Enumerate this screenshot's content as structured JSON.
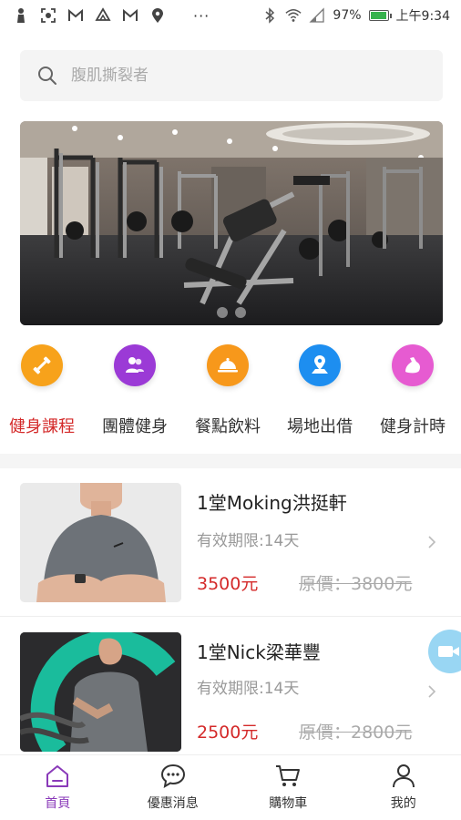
{
  "status_bar": {
    "dots": "···",
    "battery": "97%",
    "time": "上午9:34"
  },
  "search": {
    "placeholder": "腹肌撕裂者"
  },
  "banner": {
    "active_index": 0,
    "count": 2
  },
  "categories": [
    {
      "label": "健身課程",
      "icon": "dumbbell-icon",
      "color": "#f7a21b",
      "active": true
    },
    {
      "label": "團體健身",
      "icon": "group-icon",
      "color": "#9b3ad6",
      "active": false
    },
    {
      "label": "餐點飲料",
      "icon": "food-tray-icon",
      "color": "#f7981b",
      "active": false
    },
    {
      "label": "場地出借",
      "icon": "location-icon",
      "color": "#1d8ef0",
      "active": false
    },
    {
      "label": "健身計時",
      "icon": "muscle-icon",
      "color": "#e65bd1",
      "active": false
    }
  ],
  "products": [
    {
      "name": "1堂Moking洪挺軒",
      "validity": "有效期限:14天",
      "price": "3500元",
      "original_price": "原價：3800元"
    },
    {
      "name": "1堂Nick梁華豐",
      "validity": "有效期限:14天",
      "price": "2500元",
      "original_price": "原價：2800元"
    }
  ],
  "tabbar": {
    "items": [
      {
        "label": "首頁",
        "icon": "home-icon",
        "active": true
      },
      {
        "label": "優惠消息",
        "icon": "message-icon",
        "active": false
      },
      {
        "label": "購物車",
        "icon": "cart-icon",
        "active": false
      },
      {
        "label": "我的",
        "icon": "user-icon",
        "active": false
      }
    ]
  },
  "colors": {
    "accent_red": "#d42a2a",
    "tab_active": "#8a3ab9"
  }
}
